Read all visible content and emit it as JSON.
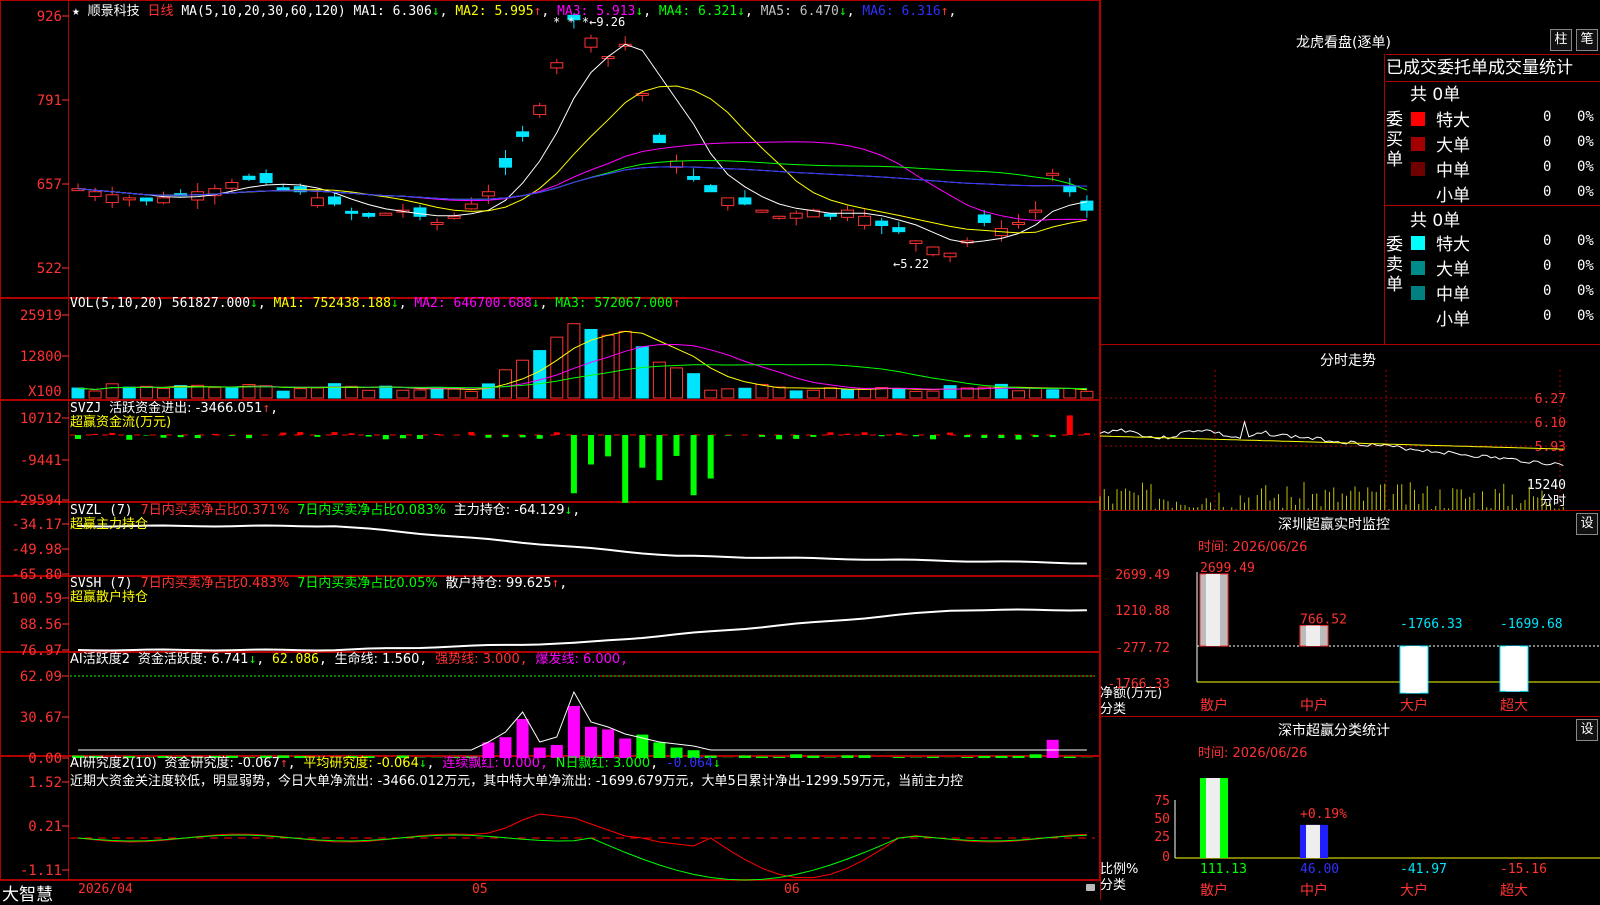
{
  "colors": {
    "up": "#ff3232",
    "down": "#00e5ff",
    "grid": "#b00000",
    "ma1": "#ffffff",
    "ma2": "#ffff00",
    "ma3": "#ff00ff",
    "ma4": "#00ff00",
    "ma5": "#c0c0c0",
    "ma6": "#3030ff",
    "green": "#00ff00",
    "magenta": "#ff00ff",
    "yellow": "#ffff00"
  },
  "stock": {
    "star": "★",
    "name": "顺景科技",
    "period": "日线"
  },
  "ma_header": {
    "params": "MA(5,10,20,30,60,120)",
    "items": [
      {
        "label": "MA1: 6.306",
        "arrow": "↓",
        "color": "#ffffff"
      },
      {
        "label": "MA2: 5.995",
        "arrow": "↑",
        "color": "#ffff00"
      },
      {
        "label": "MA3: 5.913",
        "arrow": "↓",
        "color": "#ff00ff"
      },
      {
        "label": "MA4: 6.321",
        "arrow": "↓",
        "color": "#00ff00"
      },
      {
        "label": "MA5: 6.470",
        "arrow": "↓",
        "color": "#c0c0c0"
      },
      {
        "label": "MA6: 6.316",
        "arrow": "↑",
        "color": "#3030ff"
      }
    ]
  },
  "price_axis": [
    "926",
    "791",
    "657",
    "522"
  ],
  "price_high_label": "* * *←9.26",
  "price_low_label": "←5.22",
  "vol_header": {
    "name": "VOL(5,10,20)",
    "value": "561827.000",
    "arrow": "↓",
    "ma1": "MA1: 752438.188",
    "ma1_arrow": "↓",
    "ma2": "MA2: 646700.688",
    "ma2_arrow": "↓",
    "ma3": "MA3: 572067.000",
    "ma3_arrow": "↑"
  },
  "vol_axis": [
    "25919",
    "12800"
  ],
  "vol_unit": "X100",
  "svzj_header": {
    "name": "SVZJ",
    "label": "活跃资金进出: -3466.051",
    "arrow": "↑",
    "comma": ",",
    "line2": "超赢资金流(万元)"
  },
  "svzj_axis": [
    "10712",
    "-9441",
    "-29594"
  ],
  "svzl_header": {
    "name": "SVZL (7)",
    "item1": "7日内买卖净占比0.371%",
    "item2": "7日内买卖净占比0.083%",
    "item3": "主力持仓: -64.129",
    "arrow": "↓",
    "comma": ",",
    "line2": "超赢主力持仓"
  },
  "svzl_axis": [
    "-34.17",
    "-49.98",
    "-65.80"
  ],
  "svsh_header": {
    "name": "SVSH (7)",
    "item1": "7日内买卖净占比0.483%",
    "item2": "7日内买卖净占比0.05%",
    "item3": "散户持仓: 99.625",
    "arrow": "↑",
    "comma": ",",
    "line2": "超赢散户持仓"
  },
  "svsh_axis": [
    "100.59",
    "88.56",
    "76.97"
  ],
  "ai_header": {
    "name": "AI活跃度2",
    "a": "资金活跃度: 6.741",
    "a_arrow": "↓",
    "b": "62.086",
    "c": "生命线: 1.560",
    "d": "强势线: 3.000",
    "e": "爆发线: 6.000"
  },
  "ai_axis": [
    "62.09",
    "30.67",
    "0.00"
  ],
  "air_header": {
    "name": "AI研究度2(10)",
    "a": "资金研究度: -0.067",
    "a_arrow": "↑",
    "b": "平均研究度: -0.064",
    "b_arrow": "↓",
    "c": "连续飘红: 0.000",
    "d": "N日飘红: 3.000",
    "e": "-0.064",
    "e_arrow": "↓"
  },
  "air_text": "近期大资金关注度较低，明显弱势，今日大单净流出: -3466.012万元，其中特大单净流出: -1699.679万元，大单5日累计净出-1299.59万元，当前主力控",
  "air_axis": [
    "1.52",
    "0.21",
    "-1.11"
  ],
  "bottom": {
    "brand": "大智慧",
    "date": "2026/04",
    "m05": "05",
    "m06": "06"
  },
  "lhb": {
    "title": "龙虎看盘(逐单)",
    "btn1": "柱",
    "btn2": "笔",
    "subtitle": "已成交委托单成交量统计",
    "buy_label": "委买单",
    "buy_total": "共 0单",
    "buy_rows": [
      {
        "name": "特大",
        "count": "0",
        "pct": "0%",
        "color": "#ff0000"
      },
      {
        "name": "大单",
        "count": "0",
        "pct": "0%",
        "color": "#a00000"
      },
      {
        "name": "中单",
        "count": "0",
        "pct": "0%",
        "color": "#700000"
      },
      {
        "name": "小单",
        "count": "0",
        "pct": "0%",
        "color": ""
      }
    ],
    "sell_label": "委卖单",
    "sell_total": "共 0单",
    "sell_rows": [
      {
        "name": "特大",
        "count": "0",
        "pct": "0%",
        "color": "#00ffff"
      },
      {
        "name": "大单",
        "count": "0",
        "pct": "0%",
        "color": "#008b8b"
      },
      {
        "name": "中单",
        "count": "0",
        "pct": "0%",
        "color": "#008080"
      },
      {
        "name": "小单",
        "count": "0",
        "pct": "0%",
        "color": ""
      }
    ]
  },
  "fenshi": {
    "title": "分时走势",
    "prices": [
      "6.27",
      "6.10",
      "5.93"
    ],
    "vol": "15240",
    "unit": "分时"
  },
  "szmon": {
    "title": "深圳超赢实时监控",
    "btn": "设",
    "date": "时间: 2026/06/26",
    "axis": [
      "2699.49",
      "1210.88",
      "-277.72",
      "-1766.33"
    ],
    "ylabel1": "净额(万元)",
    "ylabel2": "分类",
    "categories": [
      "散户",
      "中户",
      "大户",
      "超大"
    ],
    "values": [
      2699.49,
      766.52,
      -1766.33,
      -1699.68
    ],
    "value_labels": [
      "2699.49",
      "766.52",
      "-1766.33",
      "-1699.68"
    ]
  },
  "szstat": {
    "title": "深市超赢分类统计",
    "btn": "设",
    "date": "时间: 2026/06/26",
    "axis": [
      "75",
      "50",
      "25",
      "0"
    ],
    "ylabel1": "比例%",
    "ylabel2": "分类",
    "pct_label": "+0.19%",
    "categories": [
      "散户",
      "中户",
      "大户",
      "超大"
    ],
    "values": [
      111.13,
      46.0,
      -41.97,
      -15.16
    ],
    "value_labels": [
      "111.13",
      "46.00",
      "-41.97",
      "-15.16"
    ]
  }
}
